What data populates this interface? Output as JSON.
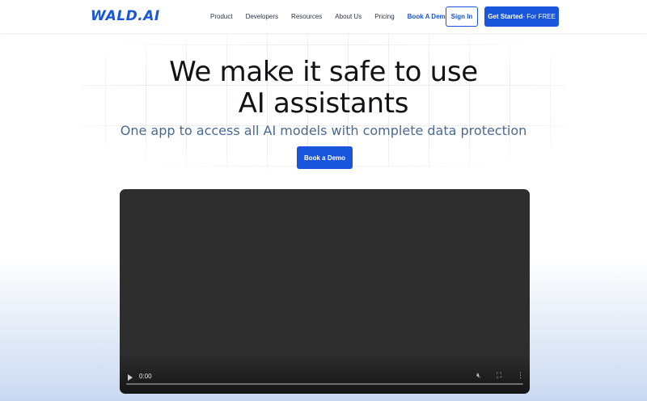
{
  "brand": {
    "logo_text": "WALD.AI",
    "accent_color": "#1a56db"
  },
  "nav": {
    "items": [
      {
        "label": "Product"
      },
      {
        "label": "Developers"
      },
      {
        "label": "Resources"
      },
      {
        "label": "About Us"
      },
      {
        "label": "Pricing"
      },
      {
        "label": "Book A Demo"
      }
    ],
    "sign_in_label": "Sign In",
    "get_started_label": "Get Started",
    "get_started_suffix": " - For FREE"
  },
  "hero": {
    "title_line1": "We make it safe to use",
    "title_line2": "AI assistants",
    "subtitle": "One app to access all AI models with complete data protection",
    "cta_label": "Book a Demo"
  },
  "video": {
    "time": "0:00",
    "progress": 0,
    "icons": [
      "play-icon",
      "mute-icon",
      "fullscreen-icon",
      "more-options-icon"
    ]
  }
}
